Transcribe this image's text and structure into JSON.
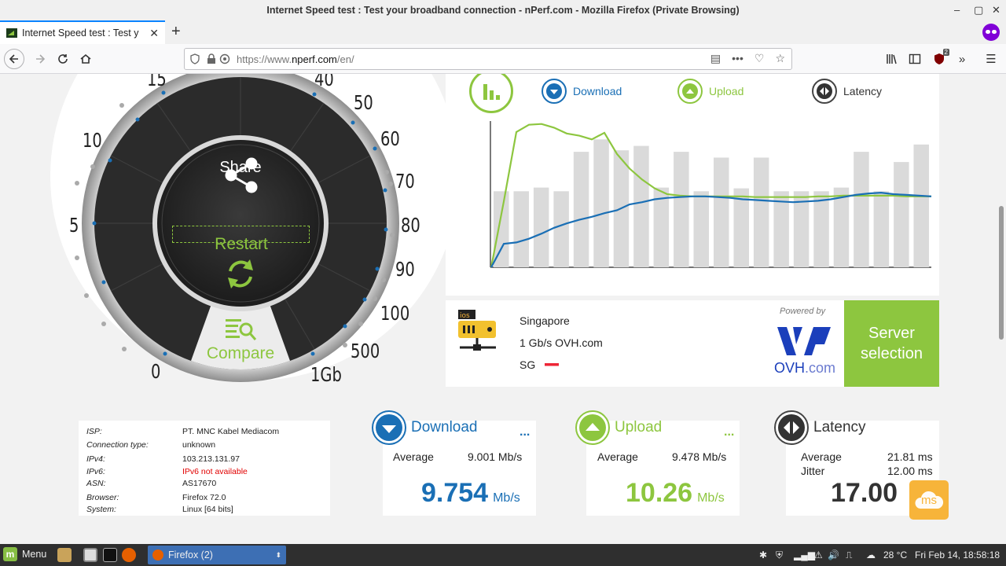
{
  "window": {
    "title": "Internet Speed test : Test your broadband connection - nPerf.com - Mozilla Firefox (Private Browsing)",
    "controls": [
      "–",
      "▢",
      "✕"
    ]
  },
  "tab": {
    "title": "Internet Speed test : Test y",
    "close": "✕",
    "new_tab": "+"
  },
  "urlbar": {
    "url_prefix": "https://www.",
    "url_domain": "nperf.com",
    "url_suffix": "/en/"
  },
  "toolbar": {
    "ublock_count": "2"
  },
  "gauge": {
    "scale_labels": [
      "0",
      "5",
      "10",
      "15",
      "40",
      "50",
      "60",
      "70",
      "80",
      "90",
      "100",
      "500",
      "1Gb"
    ],
    "share_label": "Share",
    "restart_label": "Restart",
    "compare_label": "Compare"
  },
  "legend": {
    "download": "Download",
    "upload": "Upload",
    "latency": "Latency"
  },
  "chart_data": {
    "type": "line",
    "title": "",
    "xlabel": "",
    "ylabel": "",
    "series": [
      {
        "name": "Download",
        "color": "#1a6fb5",
        "values": [
          0,
          3.2,
          3.4,
          3.9,
          4.6,
          5.4,
          6.0,
          6.5,
          6.9,
          7.4,
          7.8,
          8.6,
          8.9,
          9.3,
          9.5,
          9.6,
          9.7,
          9.7,
          9.6,
          9.5,
          9.3,
          9.2,
          9.1,
          9.0,
          8.9,
          9.0,
          9.1,
          9.3,
          9.6,
          9.9,
          10.1,
          10.2,
          10.0,
          9.9,
          9.8,
          9.7
        ]
      },
      {
        "name": "Upload",
        "color": "#8dc63f",
        "values": [
          0,
          9.0,
          18.5,
          19.5,
          19.6,
          19.1,
          18.3,
          18.0,
          17.5,
          18.4,
          15.5,
          13.5,
          12.0,
          10.8,
          10.0,
          9.8,
          9.7,
          9.7,
          9.7,
          9.7,
          9.7,
          9.6,
          9.6,
          9.6,
          9.6,
          9.6,
          9.7,
          9.7,
          9.8,
          9.8,
          9.8,
          9.8,
          9.8,
          9.7,
          9.7,
          9.7
        ]
      },
      {
        "name": "Latency",
        "color": "#dadada",
        "type": "bar",
        "values": [
          10.4,
          10.4,
          10.9,
          10.4,
          15.8,
          17.5,
          16.0,
          16.6,
          10.9,
          15.8,
          10.4,
          15.0,
          10.8,
          15.0,
          10.4,
          10.4,
          10.4,
          10.9,
          15.8,
          10.4,
          14.4,
          16.8
        ]
      }
    ]
  },
  "server": {
    "city": "Singapore",
    "provider": "1 Gb/s OVH.com",
    "country": "SG",
    "powered_by": "Powered by",
    "logo_text_ovh": "OVH",
    "logo_text_com": ".com",
    "selection_button_line1": "Server",
    "selection_button_line2": "selection"
  },
  "info": [
    {
      "k": "ISP:",
      "v": "PT. MNC Kabel Mediacom"
    },
    {
      "k": "Connection type:",
      "v": "unknown"
    },
    {
      "k": "IPv4:",
      "v": "103.213.131.97"
    },
    {
      "k": "IPv6:",
      "v": "IPv6 not available"
    },
    {
      "k": "ASN:",
      "v": "AS17670"
    },
    {
      "k": "Browser:",
      "v": "Firefox 72.0"
    },
    {
      "k": "System:",
      "v": "Linux [64 bits]"
    }
  ],
  "download": {
    "label": "Download",
    "more": "...",
    "avg_label": "Average",
    "avg_value": "9.001 Mb/s",
    "value": "9.754",
    "unit": "Mb/s"
  },
  "upload": {
    "label": "Upload",
    "more": "...",
    "avg_label": "Average",
    "avg_value": "9.478 Mb/s",
    "value": "10.26",
    "unit": "Mb/s"
  },
  "latency": {
    "label": "Latency",
    "avg_label": "Average",
    "avg_value": "21.81 ms",
    "jitter_label": "Jitter",
    "jitter_value": "12.00 ms",
    "value": "17.00",
    "unit": "ms"
  },
  "taskbar": {
    "menu_label": "Menu",
    "task_label": "Firefox (2)",
    "temperature": "28 °C",
    "clock": "Fri Feb 14, 18:58:18"
  },
  "colors": {
    "accent_green": "#8dc63f",
    "accent_blue": "#1a6fb5",
    "dark": "#2a2a2a",
    "latency_orange": "#f7b43a"
  }
}
